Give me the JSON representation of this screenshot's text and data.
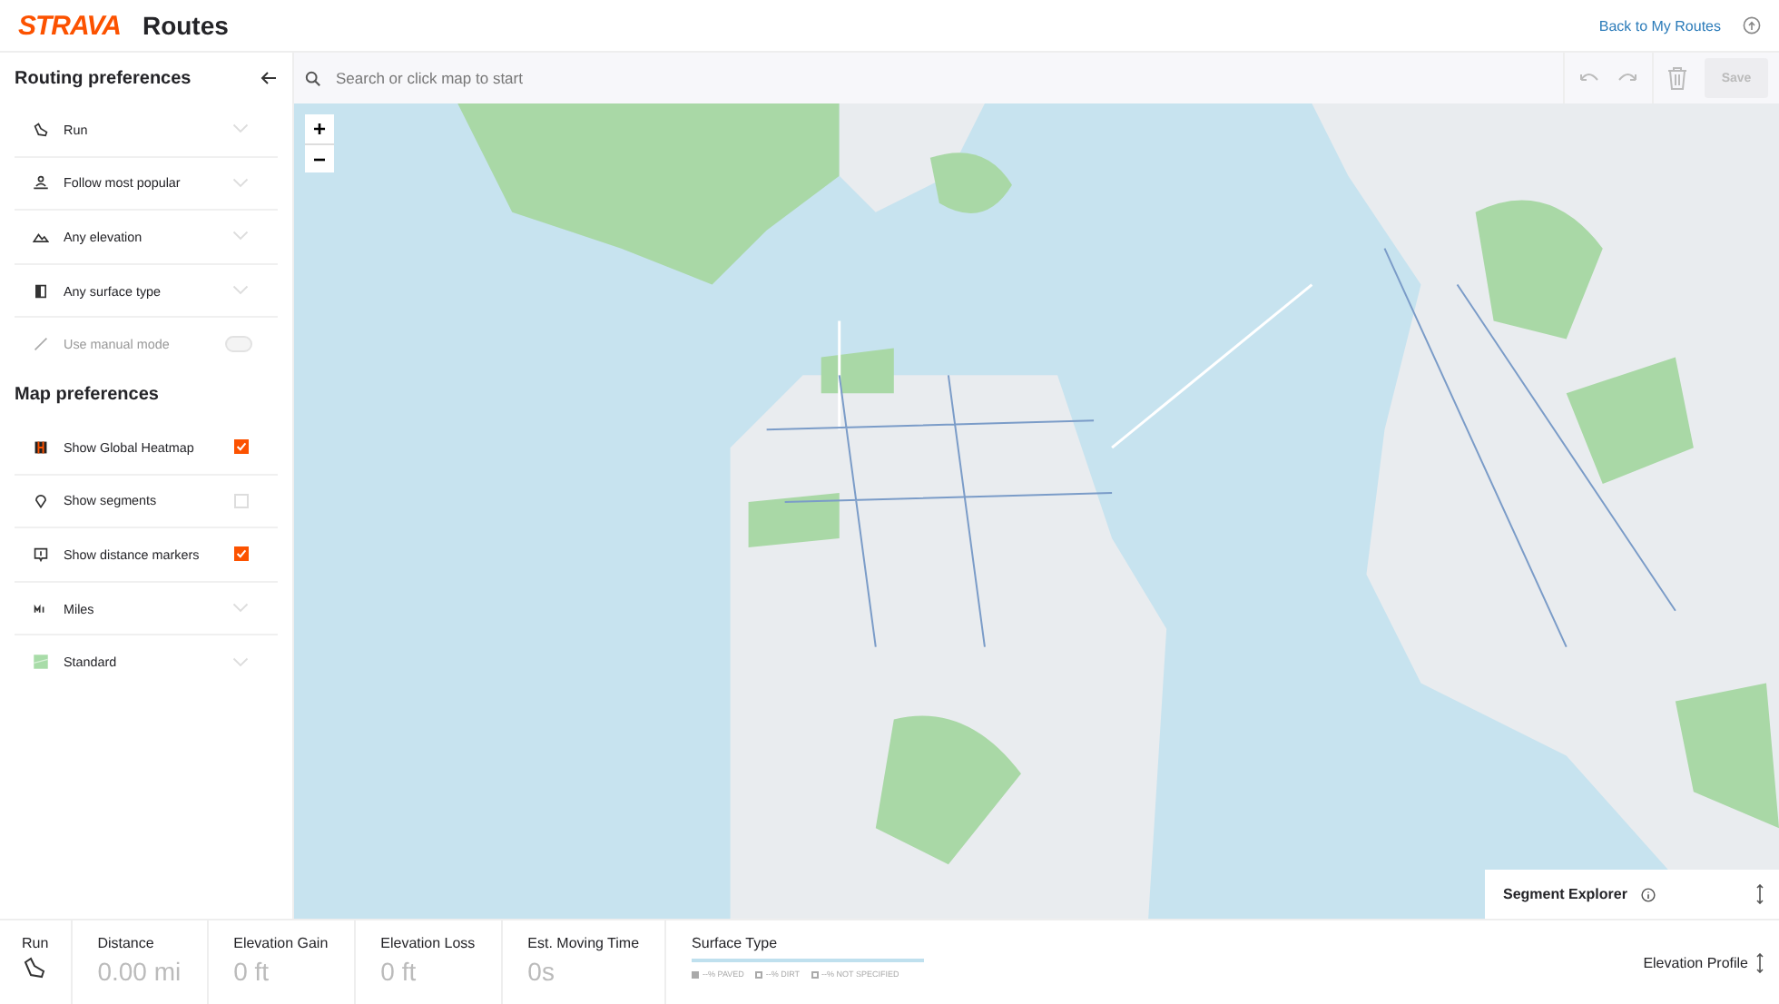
{
  "header": {
    "logo": "STRAVA",
    "title": "Routes",
    "back_link": "Back to My Routes"
  },
  "sidebar": {
    "routing_title": "Routing preferences",
    "routing_items": [
      {
        "kind": "dropdown",
        "label": "Run"
      },
      {
        "kind": "dropdown",
        "label": "Follow most popular"
      },
      {
        "kind": "dropdown",
        "label": "Any elevation"
      },
      {
        "kind": "dropdown",
        "label": "Any surface type"
      },
      {
        "kind": "toggle",
        "label": "Use manual mode",
        "on": false,
        "disabled": true
      }
    ],
    "map_title": "Map preferences",
    "map_items": [
      {
        "kind": "checkbox",
        "label": "Show Global Heatmap",
        "checked": true
      },
      {
        "kind": "checkbox",
        "label": "Show segments",
        "checked": false
      },
      {
        "kind": "checkbox",
        "label": "Show distance markers",
        "checked": true
      },
      {
        "kind": "dropdown",
        "label": "Miles"
      },
      {
        "kind": "dropdown",
        "label": "Standard"
      }
    ]
  },
  "toolbar": {
    "search_placeholder": "Search or click map to start",
    "save": {
      "label": "Save",
      "disabled": true
    }
  },
  "map": {
    "zoom_in": "+",
    "zoom_out": "−"
  },
  "segment_explorer": {
    "title": "Segment Explorer"
  },
  "stats": {
    "sport": "Run",
    "items": [
      {
        "label": "Distance",
        "value": "0.00 mi"
      },
      {
        "label": "Elevation Gain",
        "value": "0 ft"
      },
      {
        "label": "Elevation Loss",
        "value": "0 ft"
      },
      {
        "label": "Est. Moving Time",
        "value": "0s"
      }
    ],
    "surface": {
      "label": "Surface Type",
      "legend": [
        "--% PAVED",
        "--% DIRT",
        "--% NOT SPECIFIED"
      ]
    },
    "elevation_profile": "Elevation Profile"
  }
}
